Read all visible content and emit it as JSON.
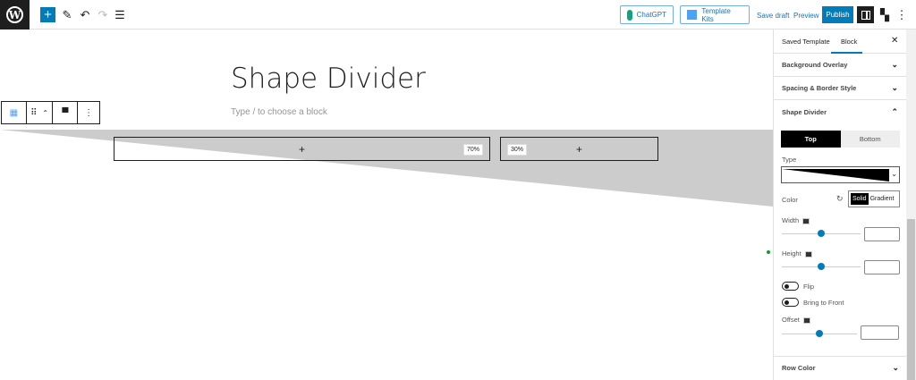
{
  "header": {
    "logo": "W",
    "chatgpt": "ChatGPT",
    "template_kits": "Template Kits",
    "save_draft": "Save draft",
    "preview": "Preview",
    "publish": "Publish"
  },
  "editor": {
    "title": "Shape Divider",
    "placeholder": "Type / to choose a block",
    "columns": [
      {
        "width_label": "70%"
      },
      {
        "width_label": "30%"
      }
    ],
    "add_symbol": "+"
  },
  "sidebar": {
    "tabs": [
      "Saved Template",
      "Block"
    ],
    "active_tab": "Block",
    "sections": [
      "Background Overlay",
      "Spacing & Border Style",
      "Shape Divider"
    ],
    "shape_divider": {
      "positions": [
        "Top",
        "Bottom"
      ],
      "active_position": "Top",
      "type_label": "Type",
      "color_label": "Color",
      "color_modes": [
        "Solid",
        "Gradient"
      ],
      "active_color_mode": "Solid",
      "width_label": "Width",
      "width_value": 0.5,
      "height_label": "Height",
      "height_value": 0.5,
      "flip_label": "Flip",
      "flip": false,
      "front_label": "Bring to Front",
      "front": false,
      "offset_label": "Offset",
      "offset_value": 0.5
    },
    "row_color": "Row Color"
  },
  "colors": {
    "accent": "#007cba",
    "shape": "#cccccc"
  }
}
